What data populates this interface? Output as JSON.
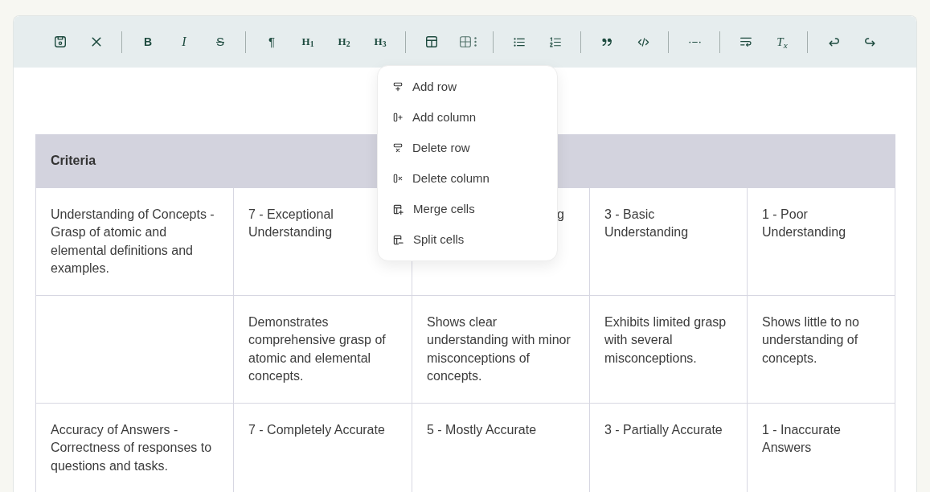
{
  "toolbar": {
    "groups": [
      [
        {
          "kind": "save"
        },
        {
          "kind": "close"
        }
      ],
      [
        {
          "kind": "bold",
          "label": "B"
        },
        {
          "kind": "italic",
          "label": "I"
        },
        {
          "kind": "strike",
          "label": "S"
        }
      ],
      [
        {
          "kind": "paragraph",
          "label": "¶"
        },
        {
          "kind": "heading",
          "label": "H$_{1}$"
        },
        {
          "kind": "heading",
          "label": "H$_{2}$"
        },
        {
          "kind": "heading",
          "label": "H$_{3}$"
        }
      ],
      [
        {
          "kind": "table"
        },
        {
          "kind": "tableoptions"
        }
      ],
      [
        {
          "kind": "bullets"
        },
        {
          "kind": "numbering"
        }
      ],
      [
        {
          "kind": "quote"
        },
        {
          "kind": "code"
        }
      ],
      [
        {
          "kind": "rule"
        }
      ],
      [
        {
          "kind": "wrap"
        },
        {
          "kind": "clearformat",
          "label": "T$_{x}$"
        }
      ],
      [
        {
          "kind": "undo"
        },
        {
          "kind": "redo"
        }
      ]
    ]
  },
  "table": {
    "header": "Criteria",
    "rows": [
      {
        "cells": [
          {
            "text": "Understanding of Concepts - Grasp of atomic and elemental definitions and examples."
          },
          {
            "text": "7 - Exceptional Understanding"
          },
          {
            "text": "g",
            "covered": true
          },
          {
            "text": "3 - Basic Understanding"
          },
          {
            "text": "1 - Poor Understanding"
          }
        ]
      },
      {
        "cells": [
          {},
          {
            "text": "Demonstrates comprehensive grasp of atomic and elemental concepts."
          },
          {
            "text": "Shows clear understanding with minor misconceptions of concepts."
          },
          {
            "text": "Exhibits limited grasp with several misconceptions."
          },
          {
            "text": "Shows little to no understanding of concepts."
          }
        ]
      },
      {
        "cells": [
          {
            "text": "Accuracy of Answers - Correctness of responses to questions and tasks."
          },
          {
            "text": "7 - Completely Accurate"
          },
          {
            "text": "5 - Mostly Accurate"
          },
          {
            "text": "3 - Partially Accurate"
          },
          {
            "text": "1 - Inaccurate Answers"
          }
        ]
      }
    ]
  },
  "table_menu": {
    "items": [
      {
        "kind": "addrow",
        "label": "Add row"
      },
      {
        "kind": "addcol",
        "label": "Add column"
      },
      {
        "kind": "delrow",
        "label": "Delete row"
      },
      {
        "kind": "delcol",
        "label": "Delete column"
      },
      {
        "kind": "merge",
        "label": "Merge cells"
      },
      {
        "kind": "split",
        "label": "Split cells"
      }
    ]
  }
}
